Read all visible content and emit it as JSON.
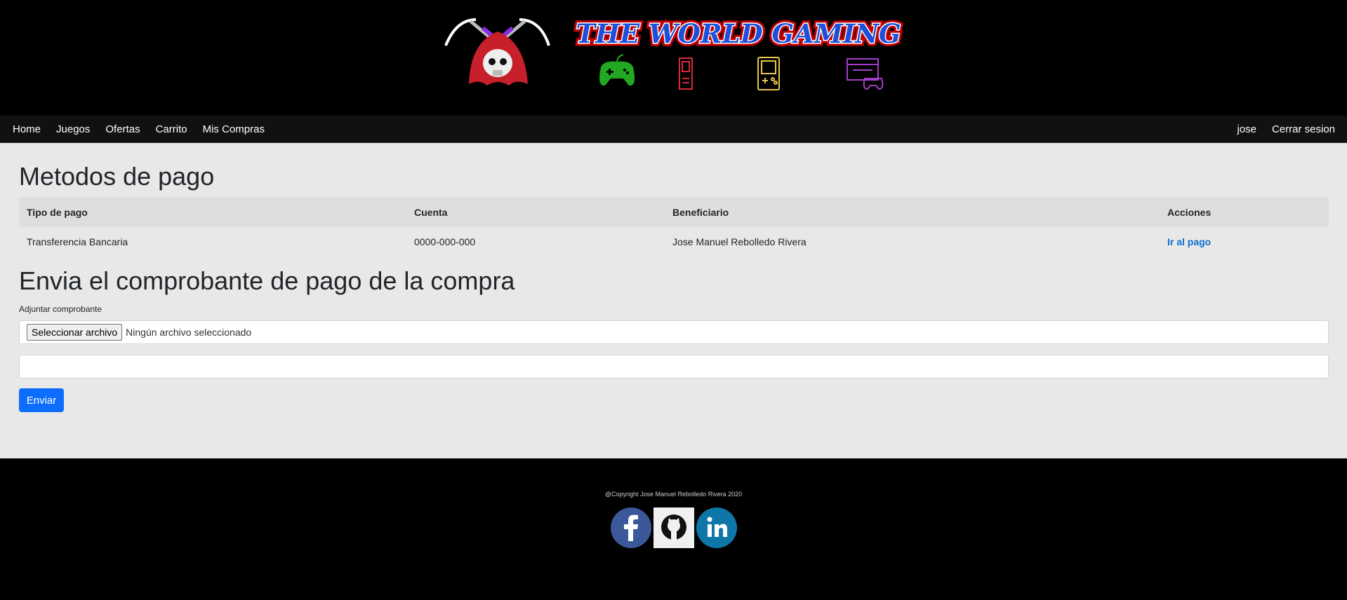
{
  "banner": {
    "title": "THE WORLD GAMING",
    "icons": [
      "reaper-skull-logo-icon",
      "gamepad-icon",
      "console-tower-icon",
      "gameboy-icon",
      "retro-console-icon"
    ]
  },
  "nav": {
    "left": [
      "Home",
      "Juegos",
      "Ofertas",
      "Carrito",
      "Mis Compras"
    ],
    "user": "jose",
    "logout": "Cerrar sesion"
  },
  "payment": {
    "title": "Metodos de pago",
    "headers": [
      "Tipo de pago",
      "Cuenta",
      "Beneficiario",
      "Acciones"
    ],
    "rows": [
      {
        "tipo": "Transferencia Bancaria",
        "cuenta": "0000-000-000",
        "beneficiario": "Jose Manuel Rebolledo Rivera",
        "accion": "Ir al pago"
      }
    ]
  },
  "upload": {
    "title": "Envia el comprobante de pago de la compra",
    "label": "Adjuntar comprobante",
    "file_button": "Seleccionar archivo",
    "file_status": "Ningún archivo seleccionado",
    "text_value": "",
    "submit": "Enviar"
  },
  "footer": {
    "copyright": "@Copyright Jose Manuel Rebolledo Rivera 2020",
    "social": [
      "facebook-icon",
      "github-icon",
      "linkedin-icon"
    ]
  },
  "colors": {
    "accent": "#0d6efd",
    "link": "#0a6ed1",
    "page_bg": "#e8e8e8",
    "nav_bg": "#111111"
  }
}
